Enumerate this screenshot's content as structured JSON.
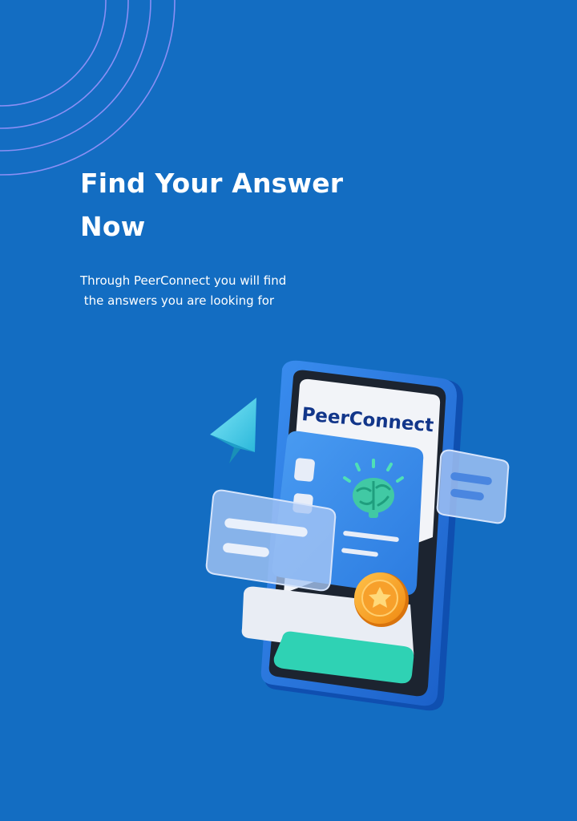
{
  "screen": {
    "background": "#136dc2",
    "ring_color": "#8b8ff5"
  },
  "hero": {
    "title_line1": "Find Your Answer",
    "title_line2": "Now",
    "subtitle_line1": "Through PeerConnect you will find",
    "subtitle_line2": " the answers you are looking for"
  },
  "illustration": {
    "brand_name": "PeerConnect",
    "icons": [
      "paper-plane-icon",
      "brain-icon",
      "star-badge-icon"
    ]
  }
}
